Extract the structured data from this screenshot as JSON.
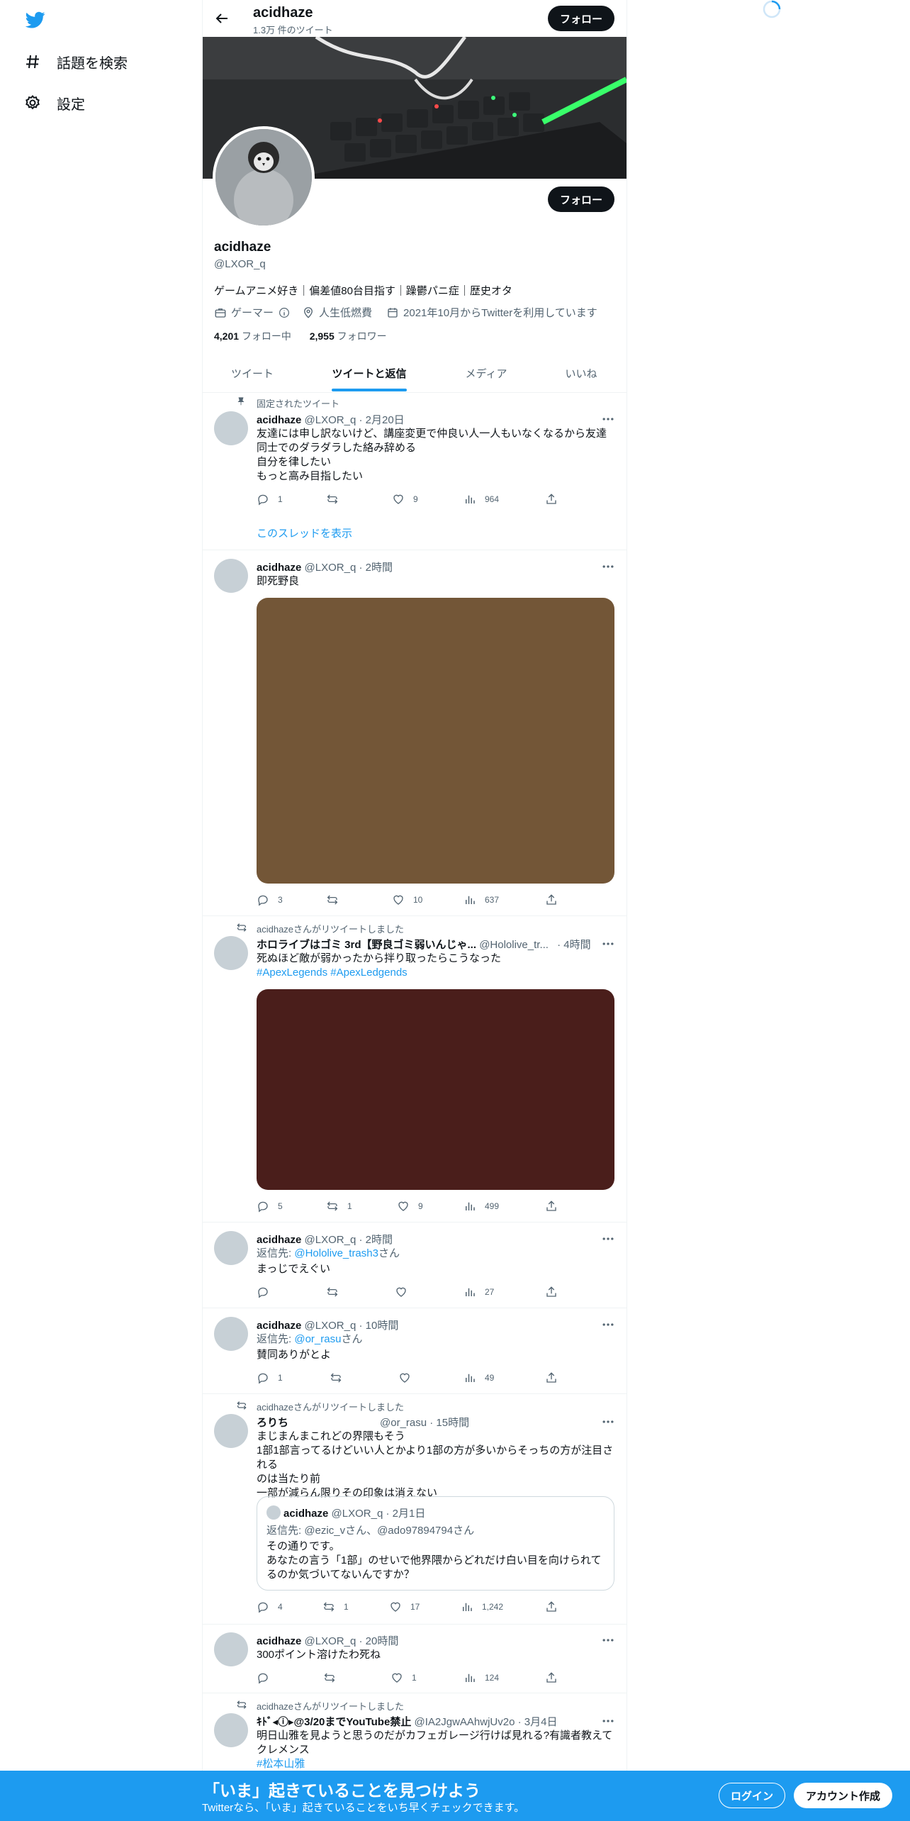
{
  "nav": {
    "explore_label": "話題を検索",
    "settings_label": "設定"
  },
  "header": {
    "title": "acidhaze",
    "tweet_count": "1.3万 件のツイート",
    "follow_label": "フォロー"
  },
  "profile": {
    "name": "acidhaze",
    "handle": "@LXOR_q",
    "bio": "ゲームアニメ好き｜偏差値80台目指す｜躁鬱パニ症｜歴史オタ",
    "category": "ゲーマー",
    "location": "人生低燃費",
    "joined": "2021年10月からTwitterを利用しています",
    "following_count": "4,201",
    "following_label": "フォロー中",
    "followers_count": "2,955",
    "followers_label": "フォロワー",
    "follow_label": "フォロー"
  },
  "tabs": [
    {
      "label": "ツイート"
    },
    {
      "label": "ツイートと返信"
    },
    {
      "label": "メディア"
    },
    {
      "label": "いいね"
    }
  ],
  "tweets": [
    {
      "pinned_label": "固定されたツイート",
      "name": "acidhaze",
      "handle": "@LXOR_q",
      "time": "· 2月20日",
      "lines": [
        "友達には申し訳ないけど、講座変更で仲良い人一人もいなくなるから友達",
        "同士でのダラダラした絡み辞める",
        "自分を律したい",
        "もっと高み目指したい"
      ],
      "replies": "1",
      "retweets": "",
      "likes": "9",
      "views": "964",
      "thread_label": "このスレッドを表示"
    },
    {
      "name": "acidhaze",
      "handle": "@LXOR_q",
      "time": "· 2時間",
      "lines": [
        "即死野良"
      ],
      "media_color": "#735637",
      "replies": "3",
      "retweets": "",
      "likes": "10",
      "views": "637"
    },
    {
      "retweet_label": "acidhazeさんがリツイートしました",
      "name": "ホロライブはゴミ 3rd【野良ゴミ弱いんじゃ...",
      "handle": "@Hololive_tr...",
      "time": "· 4時間",
      "lines": [
        "死ぬほど敵が弱かったから拌り取ったらこうなった"
      ],
      "hashtags": "#ApexLegends #ApexLedgends",
      "media_color": "#4a1e1b",
      "replies": "5",
      "retweets": "1",
      "likes": "9",
      "views": "499"
    },
    {
      "name": "acidhaze",
      "handle": "@LXOR_q",
      "time": "· 2時間",
      "reply_to_prefix": "返信先: ",
      "reply_to": "@Hololive_trash3",
      "reply_to_suffix": "さん",
      "lines": [
        "まっじでえぐい"
      ],
      "replies": "",
      "retweets": "",
      "likes": "",
      "views": "27"
    },
    {
      "name": "acidhaze",
      "handle": "@LXOR_q",
      "time": "· 10時間",
      "reply_to_prefix": "返信先: ",
      "reply_to": "@or_rasu",
      "reply_to_suffix": "さん",
      "lines": [
        "賛同ありがとよ"
      ],
      "replies": "1",
      "retweets": "",
      "likes": "",
      "views": "49"
    },
    {
      "retweet_label": "acidhazeさんがリツイートしました",
      "name": "ろりち",
      "handle": "@or_rasu",
      "time": "· 15時間",
      "lines": [
        "まじまんまこれどの界隈もそう",
        "1部1部言ってるけどいい人とかより1部の方が多いからそっちの方が注目される",
        "のは当たり前",
        "一部が減らん限りその印象は消えない"
      ],
      "quote": {
        "name": "acidhaze",
        "handle": "@LXOR_q",
        "time": "· 2月1日",
        "reply_to": "返信先: @ezic_vさん、@ado97894794さん",
        "lines": [
          "その通りです。",
          "あなたの言う「1部」のせいで他界隈からどれだけ白い目を向けられて",
          "るのか気づいてないんですか？"
        ]
      },
      "replies": "4",
      "retweets": "1",
      "likes": "17",
      "views": "1,242"
    },
    {
      "name": "acidhaze",
      "handle": "@LXOR_q",
      "time": "· 20時間",
      "lines": [
        "300ポイント溶けたわ死ね"
      ],
      "replies": "",
      "retweets": "",
      "likes": "1",
      "views": "124"
    },
    {
      "retweet_label": "acidhazeさんがリツイートしました",
      "name": "ｷﾄﾞ◂ⓘ▸@3/20までYouTube禁止",
      "handle": "@IA2JgwAAhwjUv2o",
      "time": "· 3月4日",
      "lines": [
        "明日山雅を見ようと思うのだがカフェガレージ行けば見れる?有識者教えて",
        "クレメンス"
      ],
      "hashtags": " #松本山雅"
    }
  ],
  "bottom_bar": {
    "title": "「いま」起きていることを見つけよう",
    "subtitle": "Twitterなら、「いま」起きていることをいち早くチェックできます。",
    "login_label": "ログイン",
    "signup_label": "アカウント作成"
  },
  "colors": {
    "accent": "#1d9bf0",
    "text": "#0f1419",
    "muted": "#536471"
  }
}
